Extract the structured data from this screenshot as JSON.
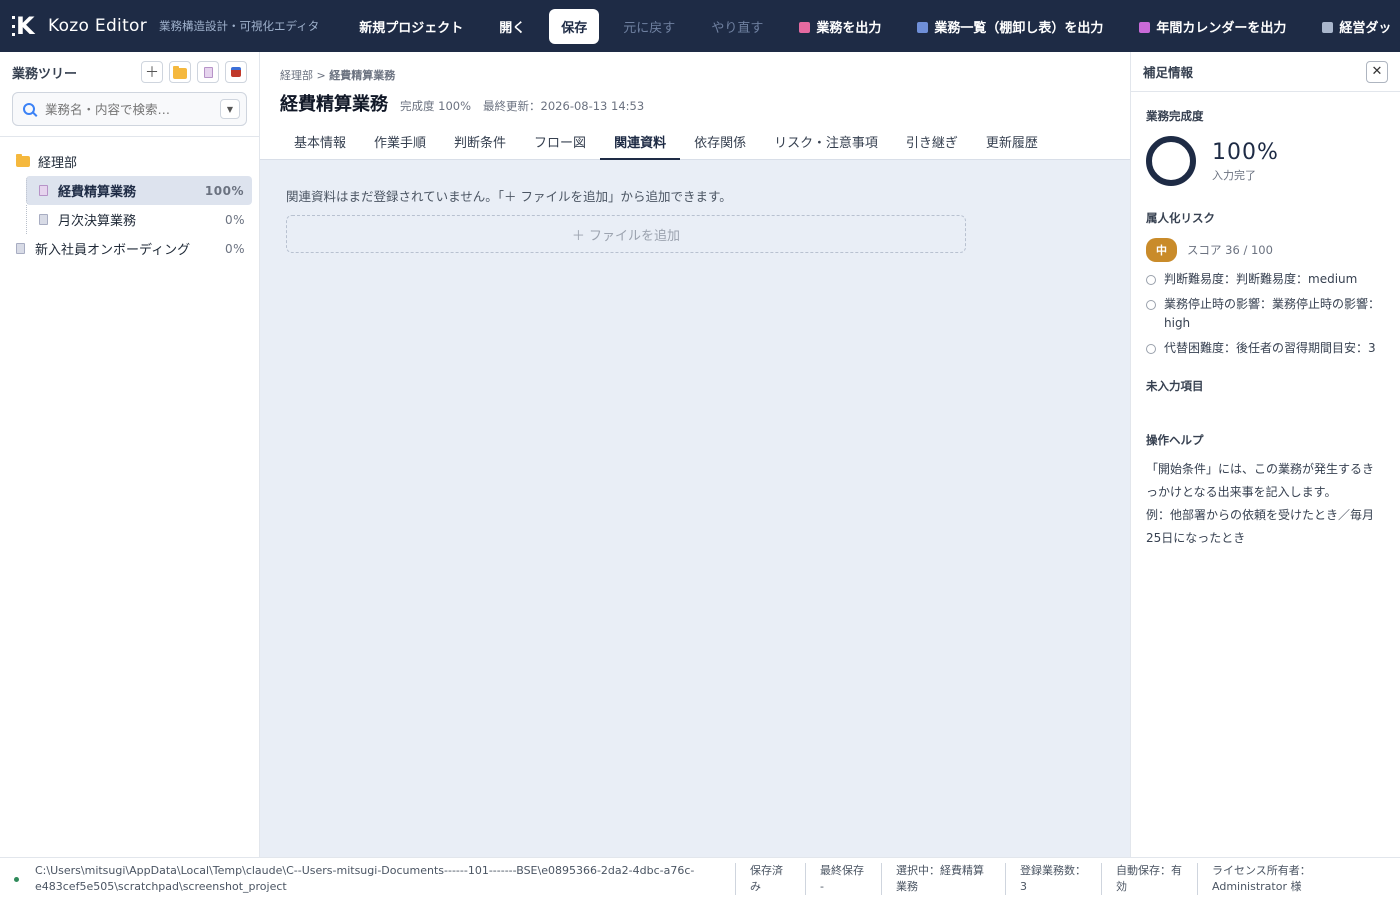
{
  "app": {
    "name": "Kozo Editor",
    "subtitle": "業務構造設計・可視化エディタ"
  },
  "toolbar": {
    "new_project": "新規プロジェクト",
    "open": "開く",
    "save": "保存",
    "undo": "元に戻す",
    "redo": "やり直す",
    "export_task": "業務を出力",
    "export_list": "業務一覧（棚卸し表）を出力",
    "export_calendar": "年間カレンダーを出力",
    "dashboard": "経営ダッ",
    "colors": {
      "export_task": "#e46aa0",
      "export_list": "#6f8fd8",
      "export_calendar": "#c86ad8",
      "dashboard": "#a9b6cc"
    }
  },
  "sidebar": {
    "title": "業務ツリー",
    "search_placeholder": "業務名・内容で検索…",
    "tools": [
      "plus-icon",
      "folder-icon",
      "document-icon",
      "import-icon"
    ],
    "tree": {
      "folder": "経理部",
      "items": [
        {
          "label": "経費精算業務",
          "pct": "100%",
          "selected": true
        },
        {
          "label": "月次決算業務",
          "pct": "0%",
          "selected": false
        }
      ],
      "root_items": [
        {
          "label": "新入社員オンボーディング",
          "pct": "0%"
        }
      ]
    }
  },
  "main": {
    "breadcrumb_parent": "経理部",
    "breadcrumb_sep": " > ",
    "breadcrumb_current": "経費精算業務",
    "title": "経費精算業務",
    "completion": "完成度 100%",
    "updated": "最終更新：2026-08-13 14:53",
    "tabs": [
      "基本情報",
      "作業手順",
      "判断条件",
      "フロー図",
      "関連資料",
      "依存関係",
      "リスク・注意事項",
      "引き継ぎ",
      "更新履歴"
    ],
    "active_tab": 4,
    "empty_message": "関連資料はまだ登録されていません。「＋ ファイルを追加」から追加できます。",
    "add_file": "＋ ファイルを追加"
  },
  "right_panel": {
    "title": "補足情報",
    "completion_label": "業務完成度",
    "completion_value": "100%",
    "completion_sub": "入力完了",
    "completion_fraction": 1.0,
    "risk_label": "属人化リスク",
    "risk_level": "中",
    "risk_score": "スコア 36 / 100",
    "risk_items": [
      "判断難易度：判断難易度：medium",
      "業務停止時の影響：業務停止時の影響：high",
      "代替困難度：後任者の習得期間目安：3"
    ],
    "missing_label": "未入力項目",
    "help_label": "操作ヘルプ",
    "help_text_1": "「開始条件」には、この業務が発生するきっかけとなる出来事を記入します。",
    "help_text_2": "例：他部署からの依頼を受けたとき／毎月25日になったとき"
  },
  "statusbar": {
    "path": "C:\\Users\\mitsugi\\AppData\\Local\\Temp\\claude\\C--Users-mitsugi-Documents------101-------BSE\\e0895366-2da2-4dbc-a76c-e483cef5e505\\scratchpad\\screenshot_project",
    "saved": "保存済み",
    "last_saved": "最終保存 -",
    "selected": "選択中：経費精算業務",
    "count": "登録業務数：3",
    "autosave": "自動保存：有効",
    "license": "ライセンス所有者：Administrator 様"
  }
}
